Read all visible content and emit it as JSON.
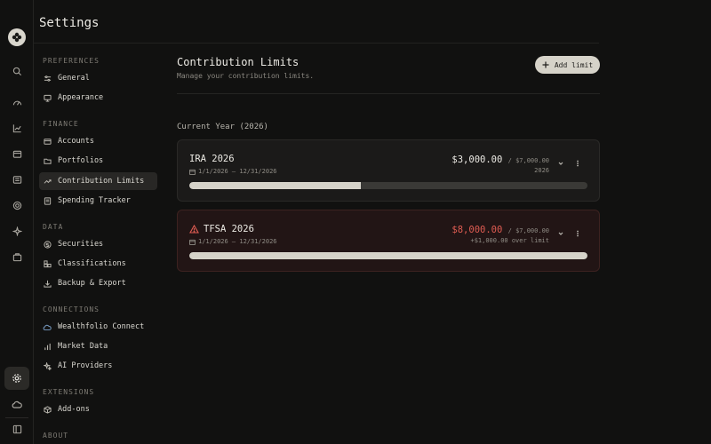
{
  "app": {
    "title": "Settings"
  },
  "nav": {
    "sections": [
      {
        "label": "PREFERENCES",
        "items": [
          {
            "label": "General",
            "icon": "sliders-icon"
          },
          {
            "label": "Appearance",
            "icon": "monitor-icon"
          }
        ]
      },
      {
        "label": "FINANCE",
        "items": [
          {
            "label": "Accounts",
            "icon": "card-icon"
          },
          {
            "label": "Portfolios",
            "icon": "folder-icon"
          },
          {
            "label": "Contribution Limits",
            "icon": "trend-icon",
            "active": true
          },
          {
            "label": "Spending Tracker",
            "icon": "receipt-icon"
          }
        ]
      },
      {
        "label": "DATA",
        "items": [
          {
            "label": "Securities",
            "icon": "dollar-circle-icon"
          },
          {
            "label": "Classifications",
            "icon": "blocks-icon"
          },
          {
            "label": "Backup & Export",
            "icon": "download-icon"
          }
        ]
      },
      {
        "label": "CONNECTIONS",
        "items": [
          {
            "label": "Wealthfolio Connect",
            "icon": "cloud-icon"
          },
          {
            "label": "Market Data",
            "icon": "bar-chart-icon"
          },
          {
            "label": "AI Providers",
            "icon": "sparkles-icon"
          }
        ]
      },
      {
        "label": "EXTENSIONS",
        "items": [
          {
            "label": "Add-ons",
            "icon": "package-icon"
          }
        ]
      },
      {
        "label": "ABOUT",
        "items": []
      }
    ]
  },
  "main": {
    "title": "Contribution Limits",
    "subtitle": "Manage your contribution limits.",
    "add_label": "Add limit",
    "year_label": "Current Year (2026)",
    "limits": [
      {
        "name": "IRA 2026",
        "dates": "1/1/2026 – 12/31/2026",
        "amount": "$3,000.00",
        "limit": "/ $7,000.00",
        "note": "2026",
        "progress": 0.43,
        "over": false
      },
      {
        "name": "TFSA 2026",
        "dates": "1/1/2026 – 12/31/2026",
        "amount": "$8,000.00",
        "limit": "/ $7,000.00",
        "note": "+$1,000.00 over limit",
        "progress": 1.0,
        "over": true
      }
    ]
  },
  "colors": {
    "background": "#111110",
    "accent": "#d6d3c9",
    "danger": "#e05c52"
  }
}
